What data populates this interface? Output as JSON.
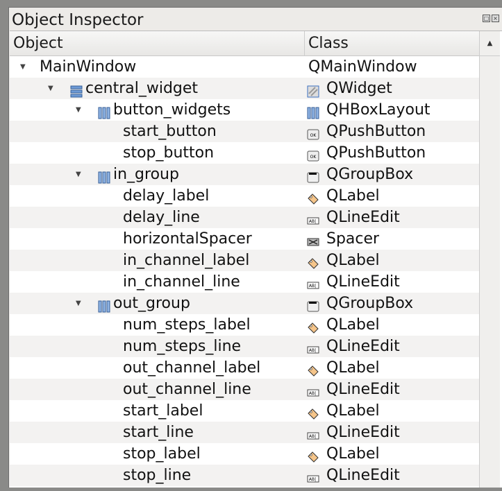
{
  "title": "Object Inspector",
  "header": {
    "object": "Object",
    "class": "Class"
  },
  "rows": [
    {
      "name": "MainWindow",
      "class": "QMainWindow",
      "depth": 0,
      "expand": true,
      "obj_icon": "",
      "class_icon": ""
    },
    {
      "name": "central_widget",
      "class": "QWidget",
      "depth": 1,
      "expand": true,
      "obj_icon": "vbox-layout-icon",
      "class_icon": "widget-icon"
    },
    {
      "name": "button_widgets",
      "class": "QHBoxLayout",
      "depth": 2,
      "expand": true,
      "obj_icon": "hbox-layout-icon",
      "class_icon": "hbox-layout-icon"
    },
    {
      "name": "start_button",
      "class": "QPushButton",
      "depth": 3,
      "class_icon": "push-button-icon"
    },
    {
      "name": "stop_button",
      "class": "QPushButton",
      "depth": 3,
      "class_icon": "push-button-icon"
    },
    {
      "name": "in_group",
      "class": "QGroupBox",
      "depth": 2,
      "expand": true,
      "obj_icon": "hbox-layout-icon",
      "class_icon": "group-box-icon"
    },
    {
      "name": "delay_label",
      "class": "QLabel",
      "depth": 3,
      "class_icon": "label-icon"
    },
    {
      "name": "delay_line",
      "class": "QLineEdit",
      "depth": 3,
      "class_icon": "line-edit-icon"
    },
    {
      "name": "horizontalSpacer",
      "class": "Spacer",
      "depth": 3,
      "class_icon": "spacer-icon"
    },
    {
      "name": "in_channel_label",
      "class": "QLabel",
      "depth": 3,
      "class_icon": "label-icon"
    },
    {
      "name": "in_channel_line",
      "class": "QLineEdit",
      "depth": 3,
      "class_icon": "line-edit-icon"
    },
    {
      "name": "out_group",
      "class": "QGroupBox",
      "depth": 2,
      "expand": true,
      "obj_icon": "hbox-layout-icon",
      "class_icon": "group-box-icon"
    },
    {
      "name": "num_steps_label",
      "class": "QLabel",
      "depth": 3,
      "class_icon": "label-icon"
    },
    {
      "name": "num_steps_line",
      "class": "QLineEdit",
      "depth": 3,
      "class_icon": "line-edit-icon"
    },
    {
      "name": "out_channel_label",
      "class": "QLabel",
      "depth": 3,
      "class_icon": "label-icon"
    },
    {
      "name": "out_channel_line",
      "class": "QLineEdit",
      "depth": 3,
      "class_icon": "line-edit-icon"
    },
    {
      "name": "start_label",
      "class": "QLabel",
      "depth": 3,
      "class_icon": "label-icon"
    },
    {
      "name": "start_line",
      "class": "QLineEdit",
      "depth": 3,
      "class_icon": "line-edit-icon"
    },
    {
      "name": "stop_label",
      "class": "QLabel",
      "depth": 3,
      "class_icon": "label-icon"
    },
    {
      "name": "stop_line",
      "class": "QLineEdit",
      "depth": 3,
      "class_icon": "line-edit-icon"
    }
  ]
}
